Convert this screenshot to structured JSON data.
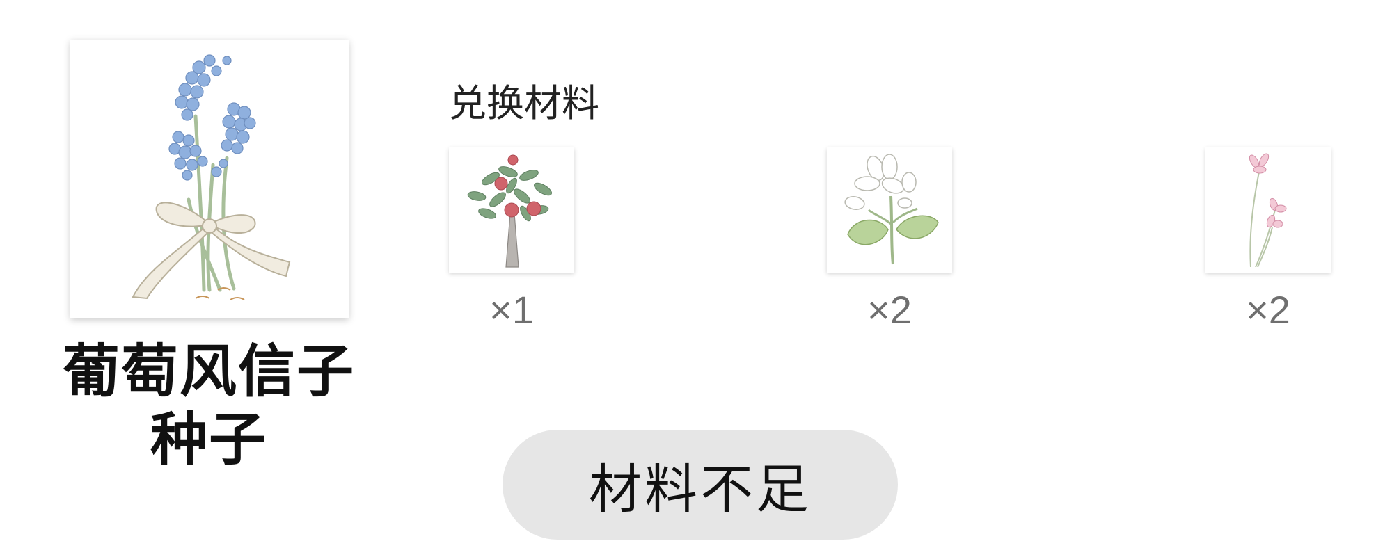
{
  "item": {
    "name_line1": "葡萄风信子",
    "name_line2": "种子",
    "icon": "grape-hyacinth-bouquet-icon"
  },
  "materials_section": {
    "label": "兑换材料",
    "materials": [
      {
        "icon": "pomegranate-tree-icon",
        "quantity": "×1"
      },
      {
        "icon": "white-magnolia-flower-icon",
        "quantity": "×2"
      },
      {
        "icon": "pink-cyclamen-flower-icon",
        "quantity": "×2"
      }
    ]
  },
  "action": {
    "label": "材料不足",
    "background_color": "#e6e6e6"
  }
}
